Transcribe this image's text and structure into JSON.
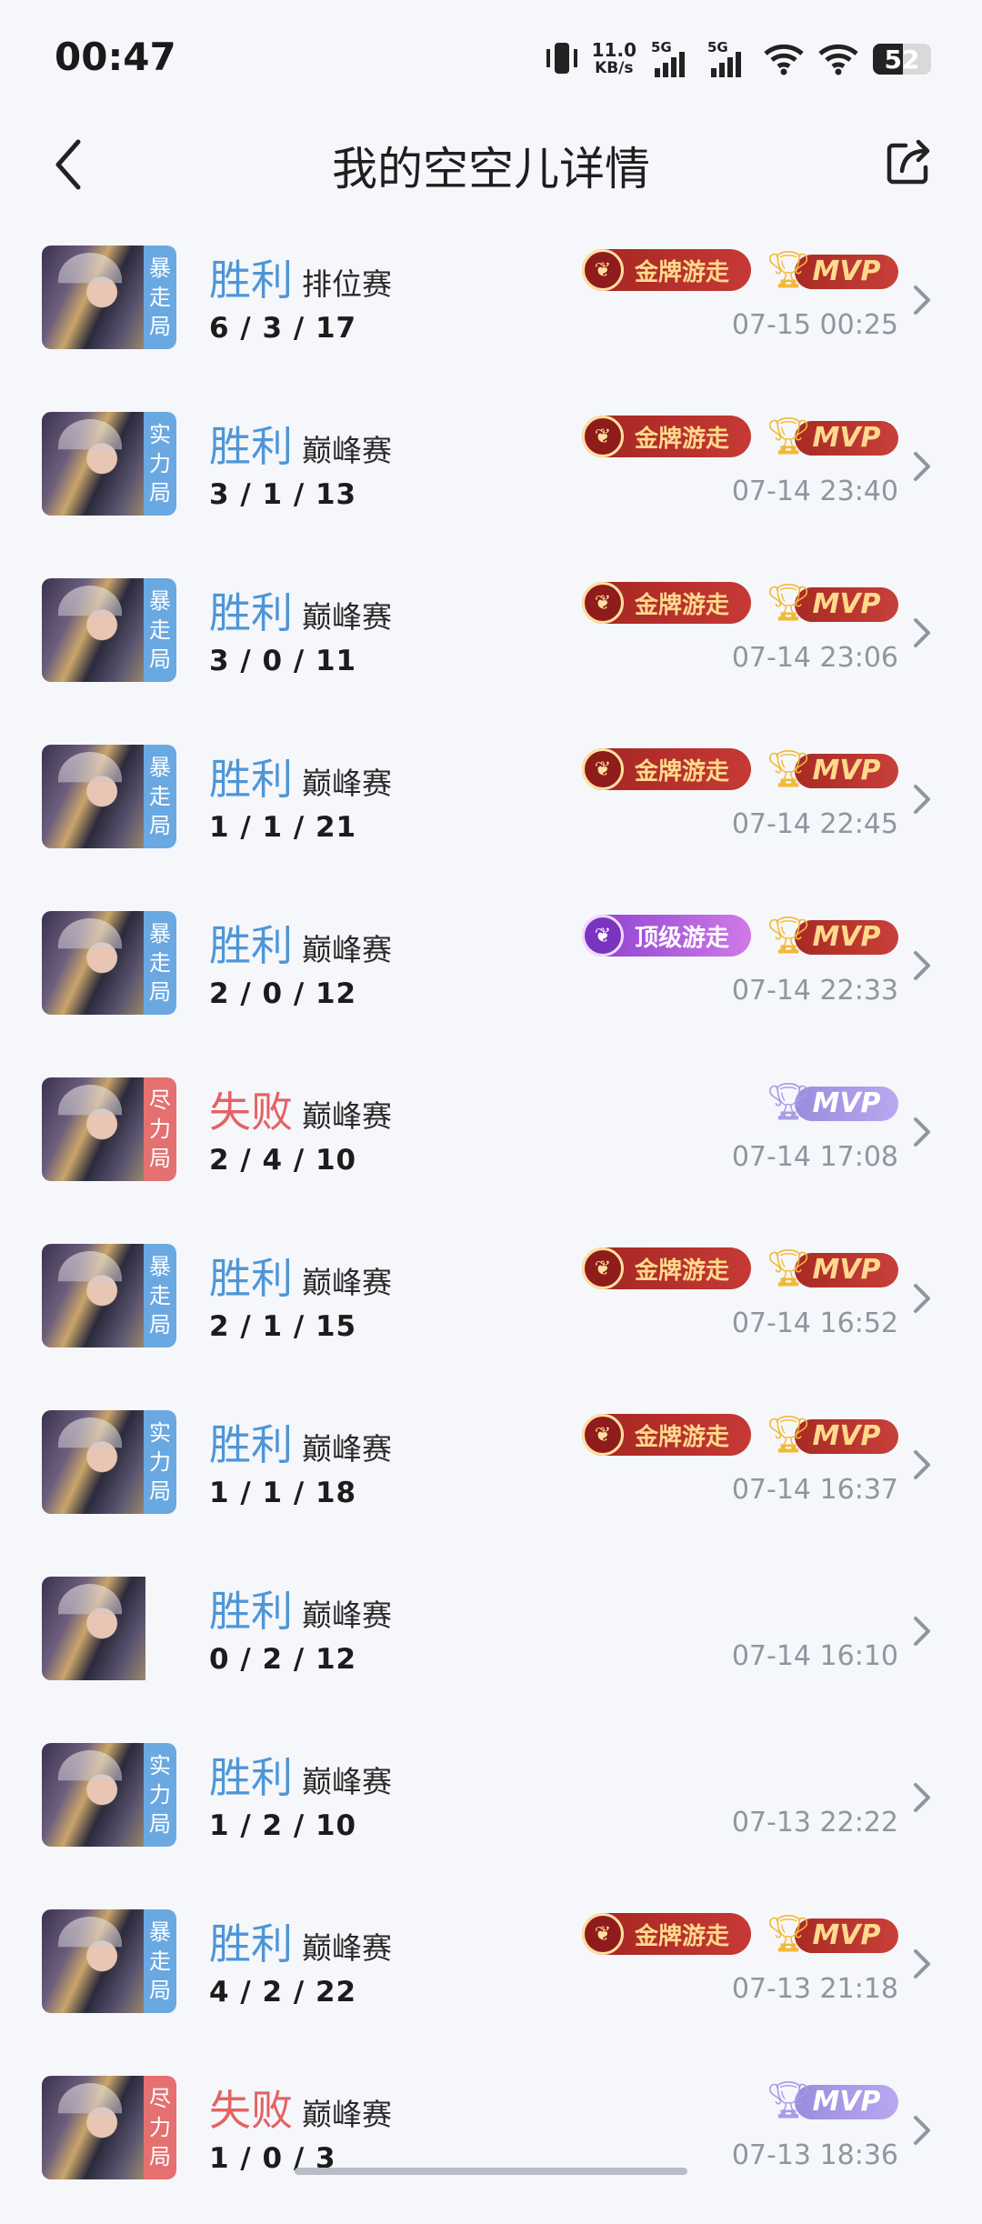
{
  "status_bar": {
    "time": "00:47",
    "net_speed_value": "11.0",
    "net_speed_unit": "KB/s",
    "sim1_label": "5G",
    "sim2_label": "5G",
    "battery": "52"
  },
  "header": {
    "title": "我的空空儿详情"
  },
  "colors": {
    "win": "#4f95d6",
    "lose": "#e56262",
    "tag_blue": "#6aa8e2",
    "tag_red": "#e47070",
    "time_gray": "#8f96a0"
  },
  "matches": [
    {
      "result": "胜利",
      "result_type": "win",
      "mode": "排位赛",
      "kda": "6 / 3 / 17",
      "tag": "暴走局",
      "tag_color": "blue",
      "title_badge": "金牌游走",
      "title_style": "gold",
      "mvp": true,
      "mvp_style": "gold",
      "time": "07-15 00:25"
    },
    {
      "result": "胜利",
      "result_type": "win",
      "mode": "巅峰赛",
      "kda": "3 / 1 / 13",
      "tag": "实力局",
      "tag_color": "blue",
      "title_badge": "金牌游走",
      "title_style": "gold",
      "mvp": true,
      "mvp_style": "gold",
      "time": "07-14 23:40"
    },
    {
      "result": "胜利",
      "result_type": "win",
      "mode": "巅峰赛",
      "kda": "3 / 0 / 11",
      "tag": "暴走局",
      "tag_color": "blue",
      "title_badge": "金牌游走",
      "title_style": "gold",
      "mvp": true,
      "mvp_style": "gold",
      "time": "07-14 23:06"
    },
    {
      "result": "胜利",
      "result_type": "win",
      "mode": "巅峰赛",
      "kda": "1 / 1 / 21",
      "tag": "暴走局",
      "tag_color": "blue",
      "title_badge": "金牌游走",
      "title_style": "gold",
      "mvp": true,
      "mvp_style": "gold",
      "time": "07-14 22:45"
    },
    {
      "result": "胜利",
      "result_type": "win",
      "mode": "巅峰赛",
      "kda": "2 / 0 / 12",
      "tag": "暴走局",
      "tag_color": "blue",
      "title_badge": "顶级游走",
      "title_style": "purple",
      "mvp": true,
      "mvp_style": "gold",
      "time": "07-14 22:33"
    },
    {
      "result": "失败",
      "result_type": "lose",
      "mode": "巅峰赛",
      "kda": "2 / 4 / 10",
      "tag": "尽力局",
      "tag_color": "red",
      "title_badge": "",
      "title_style": "",
      "mvp": true,
      "mvp_style": "purple",
      "time": "07-14 17:08"
    },
    {
      "result": "胜利",
      "result_type": "win",
      "mode": "巅峰赛",
      "kda": "2 / 1 / 15",
      "tag": "暴走局",
      "tag_color": "blue",
      "title_badge": "金牌游走",
      "title_style": "gold",
      "mvp": true,
      "mvp_style": "gold",
      "time": "07-14 16:52"
    },
    {
      "result": "胜利",
      "result_type": "win",
      "mode": "巅峰赛",
      "kda": "1 / 1 / 18",
      "tag": "实力局",
      "tag_color": "blue",
      "title_badge": "金牌游走",
      "title_style": "gold",
      "mvp": true,
      "mvp_style": "gold",
      "time": "07-14 16:37"
    },
    {
      "result": "胜利",
      "result_type": "win",
      "mode": "巅峰赛",
      "kda": "0 / 2 / 12",
      "tag": "",
      "tag_color": "none",
      "title_badge": "",
      "title_style": "",
      "mvp": false,
      "mvp_style": "",
      "time": "07-14 16:10"
    },
    {
      "result": "胜利",
      "result_type": "win",
      "mode": "巅峰赛",
      "kda": "1 / 2 / 10",
      "tag": "实力局",
      "tag_color": "blue",
      "title_badge": "",
      "title_style": "",
      "mvp": false,
      "mvp_style": "",
      "time": "07-13 22:22"
    },
    {
      "result": "胜利",
      "result_type": "win",
      "mode": "巅峰赛",
      "kda": "4 / 2 / 22",
      "tag": "暴走局",
      "tag_color": "blue",
      "title_badge": "金牌游走",
      "title_style": "gold",
      "mvp": true,
      "mvp_style": "gold",
      "time": "07-13 21:18"
    },
    {
      "result": "失败",
      "result_type": "lose",
      "mode": "巅峰赛",
      "kda": "1 / 0 / 3",
      "tag": "尽力局",
      "tag_color": "red",
      "title_badge": "",
      "title_style": "",
      "mvp": true,
      "mvp_style": "purple",
      "time": "07-13 18:36"
    }
  ],
  "mvp_label": "MVP",
  "icons": {
    "back": "chevron-left-icon",
    "share": "share-icon",
    "row_arrow": "chevron-right-icon"
  }
}
